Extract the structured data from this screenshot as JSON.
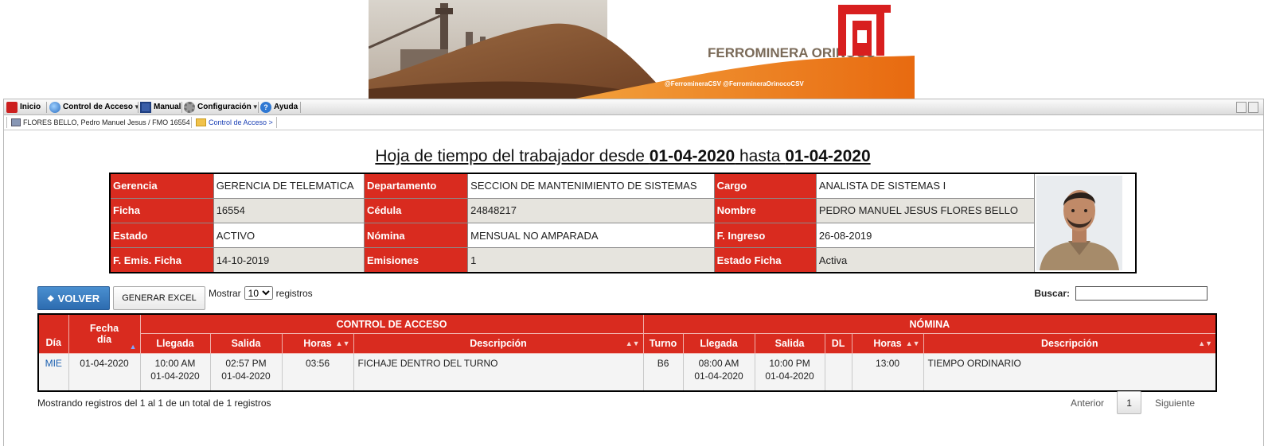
{
  "banner": {
    "brand": "FERROMINERA ORINOCO",
    "social": "@FerromineraCSV  @FerromineraOrinocoCSV"
  },
  "menu": {
    "items": [
      {
        "label": "Inicio"
      },
      {
        "label": "Control de Acceso"
      },
      {
        "label": "Manual"
      },
      {
        "label": "Configuración"
      },
      {
        "label": "Ayuda"
      }
    ]
  },
  "breadcrumb": {
    "user": "FLORES BELLO, Pedro Manuel Jesus / FMO 16554",
    "section": "Control de Acceso >"
  },
  "title": {
    "prefix": "Hoja de tiempo del trabajador desde ",
    "from": "01-04-2020",
    "middle": " hasta ",
    "to": "01-04-2020"
  },
  "info": {
    "rows": [
      [
        {
          "label": "Gerencia",
          "value": "GERENCIA DE TELEMATICA"
        },
        {
          "label": "Departamento",
          "value": "SECCION DE MANTENIMIENTO DE SISTEMAS"
        },
        {
          "label": "Cargo",
          "value": "ANALISTA DE SISTEMAS I"
        }
      ],
      [
        {
          "label": "Ficha",
          "value": "16554"
        },
        {
          "label": "Cédula",
          "value": "24848217"
        },
        {
          "label": "Nombre",
          "value": "PEDRO MANUEL JESUS FLORES BELLO"
        }
      ],
      [
        {
          "label": "Estado",
          "value": "ACTIVO"
        },
        {
          "label": "Nómina",
          "value": "MENSUAL NO AMPARADA"
        },
        {
          "label": "F. Ingreso",
          "value": "26-08-2019"
        }
      ],
      [
        {
          "label": "F. Emis. Ficha",
          "value": "14-10-2019"
        },
        {
          "label": "Emisiones",
          "value": "1"
        },
        {
          "label": "Estado Ficha",
          "value": "Activa"
        }
      ]
    ]
  },
  "controls": {
    "volver": "VOLVER",
    "excel": "GENERAR EXCEL",
    "mostrar": "Mostrar",
    "page_length": "10",
    "page_length_options": [
      "10"
    ],
    "registros": "registros",
    "buscar": "Buscar:",
    "search_value": ""
  },
  "grid": {
    "group_headers": {
      "control": "CONTROL DE ACCESO",
      "nomina": "NÓMINA"
    },
    "headers": {
      "dia": "Día",
      "fecha_1": "Fecha",
      "fecha_2": "día",
      "ca_llegada": "Llegada",
      "ca_salida": "Salida",
      "ca_horas": "Horas",
      "ca_descripcion": "Descripción",
      "turno": "Turno",
      "n_llegada": "Llegada",
      "n_salida": "Salida",
      "dl": "DL",
      "n_horas": "Horas",
      "n_descripcion": "Descripción"
    },
    "rows": [
      {
        "dia": "MIE",
        "fecha": "01-04-2020",
        "ca_llegada_hora": "10:00 AM",
        "ca_llegada_fecha": "01-04-2020",
        "ca_salida_hora": "02:57 PM",
        "ca_salida_fecha": "01-04-2020",
        "ca_horas": "03:56",
        "ca_descripcion": "FICHAJE DENTRO DEL TURNO",
        "turno": "B6",
        "n_llegada_hora": "08:00 AM",
        "n_llegada_fecha": "01-04-2020",
        "n_salida_hora": "10:00 PM",
        "n_salida_fecha": "01-04-2020",
        "dl": "",
        "n_horas": "13:00",
        "n_descripcion": "TIEMPO ORDINARIO"
      }
    ]
  },
  "footer": {
    "summary": "Mostrando registros del 1 al 1 de un total de 1 registros",
    "prev": "Anterior",
    "page": "1",
    "next": "Siguiente"
  },
  "colors": {
    "header_red": "#d92b1f",
    "primary_blue": "#2d6cb0",
    "banner_orange": "#ef7d1a"
  }
}
